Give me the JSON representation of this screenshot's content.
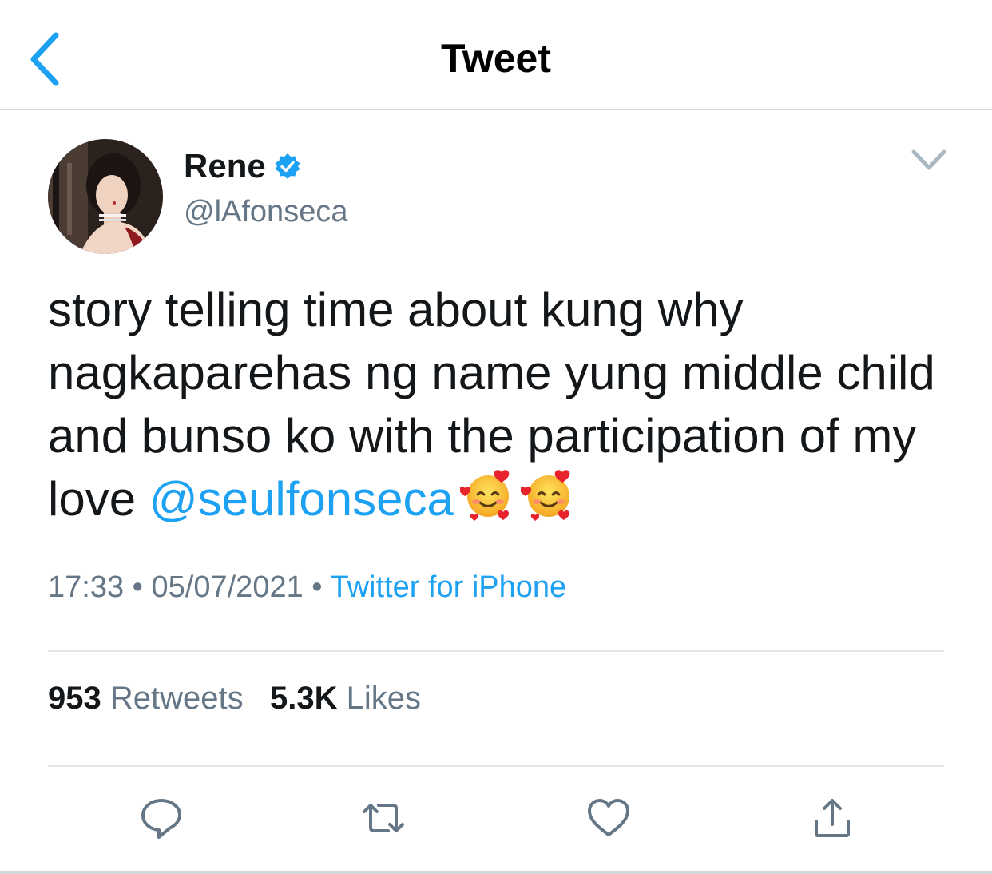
{
  "header": {
    "title": "Tweet",
    "back_icon": "chevron-left-icon"
  },
  "author": {
    "display_name": "Rene",
    "handle": "@lAfonseca",
    "verified": true,
    "avatar_icon": "avatar-photo"
  },
  "tweet": {
    "text": "story telling time about kung why nagkaparehas ng name yung middle child and bunso ko with the participation of my love ",
    "mention": "@seulfonseca",
    "emojis": [
      "smiling-face-with-hearts",
      "smiling-face-with-hearts"
    ]
  },
  "meta": {
    "time": "17:33",
    "separator": "•",
    "date": "05/07/2021",
    "source": "Twitter for iPhone"
  },
  "stats": {
    "retweets_count": "953",
    "retweets_label": "Retweets",
    "likes_count": "5.3K",
    "likes_label": "Likes"
  },
  "actions": {
    "reply_icon": "reply-icon",
    "retweet_icon": "retweet-icon",
    "like_icon": "heart-icon",
    "share_icon": "share-icon"
  },
  "colors": {
    "accent": "#1da1f2",
    "text_primary": "#14171a",
    "text_secondary": "#657786",
    "divider": "#e1e8ed",
    "icon_gray": "#657786"
  }
}
